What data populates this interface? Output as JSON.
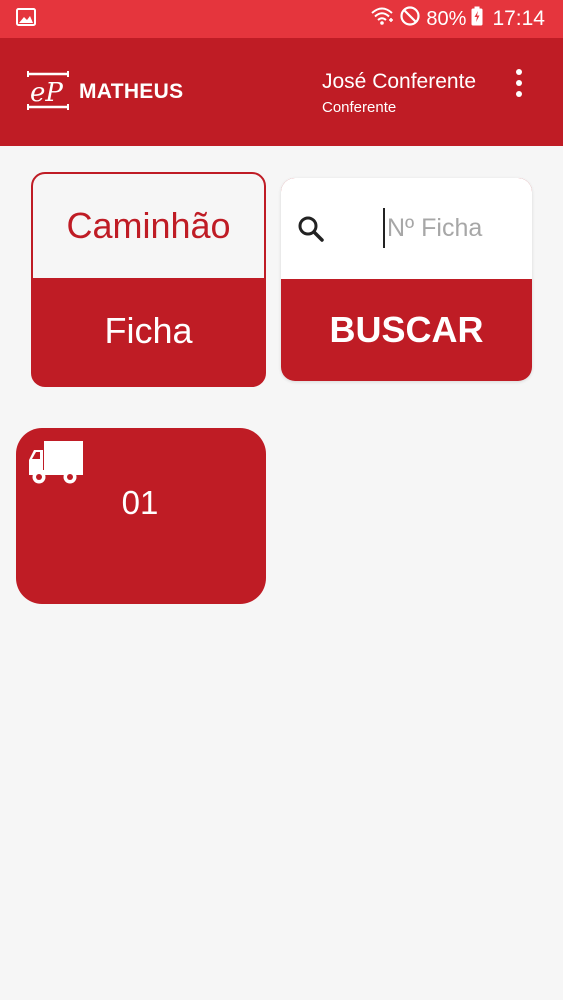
{
  "status_bar": {
    "battery": "80%",
    "time": "17:14",
    "icons": [
      "image-icon",
      "wifi-icon",
      "do-not-disturb-icon",
      "battery-charging-icon"
    ]
  },
  "app_bar": {
    "logo_text": "eP",
    "app_name": "MATHEUS",
    "user_name": "José Conferente",
    "user_role": "Conferente",
    "menu_icon": "more-vert-icon"
  },
  "mode_toggle": {
    "top_label": "Caminhão",
    "bottom_label": "Ficha"
  },
  "search": {
    "placeholder": "Nº Ficha",
    "value": "",
    "button_label": "BUSCAR",
    "icon": "search-icon"
  },
  "results": [
    {
      "icon": "truck-icon",
      "label": "01"
    }
  ],
  "colors": {
    "primary": "#bf1c25",
    "status_bar": "#e5353d",
    "background": "#f6f6f6"
  }
}
